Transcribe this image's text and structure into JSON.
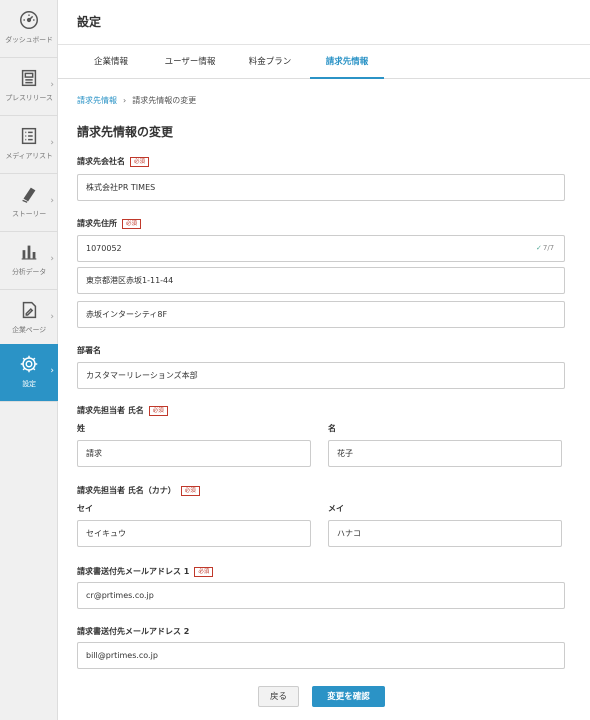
{
  "sidebar": {
    "items": [
      {
        "label": "ダッシュボード",
        "icon": "dashboard-icon"
      },
      {
        "label": "プレスリリース",
        "icon": "press-release-icon"
      },
      {
        "label": "メディアリスト",
        "icon": "media-list-icon"
      },
      {
        "label": "ストーリー",
        "icon": "story-icon"
      },
      {
        "label": "分析データ",
        "icon": "analytics-icon"
      },
      {
        "label": "企業ページ",
        "icon": "company-page-icon"
      },
      {
        "label": "設定",
        "icon": "gear-icon"
      }
    ]
  },
  "header": {
    "title": "設定"
  },
  "tabs": [
    {
      "label": "企業情報"
    },
    {
      "label": "ユーザー情報"
    },
    {
      "label": "料金プラン"
    },
    {
      "label": "請求先情報"
    }
  ],
  "breadcrumb": {
    "parent": "請求先情報",
    "current": "請求先情報の変更"
  },
  "page_title": "請求先情報の変更",
  "required_badge": "必須",
  "form": {
    "company": {
      "label": "請求先会社名",
      "value": "株式会社PR TIMES"
    },
    "address": {
      "label": "請求先住所",
      "postal": "1070052",
      "postal_counter": "7/7",
      "line1": "東京都港区赤坂1-11-44",
      "line2": "赤坂インターシティ8F"
    },
    "department": {
      "label": "部署名",
      "value": "カスタマーリレーションズ本部"
    },
    "name": {
      "label": "請求先担当者 氏名",
      "last_label": "姓",
      "last": "請求",
      "first_label": "名",
      "first": "花子"
    },
    "kana": {
      "label": "請求先担当者 氏名（カナ）",
      "last_label": "セイ",
      "last": "セイキュウ",
      "first_label": "メイ",
      "first": "ハナコ"
    },
    "email1": {
      "label": "請求書送付先メールアドレス 1",
      "value": "cr@prtimes.co.jp"
    },
    "email2": {
      "label": "請求書送付先メールアドレス 2",
      "value": "bill@prtimes.co.jp"
    }
  },
  "buttons": {
    "back": "戻る",
    "confirm": "変更を確認"
  },
  "colors": {
    "accent": "#2b93c6",
    "required": "#c0392b"
  }
}
